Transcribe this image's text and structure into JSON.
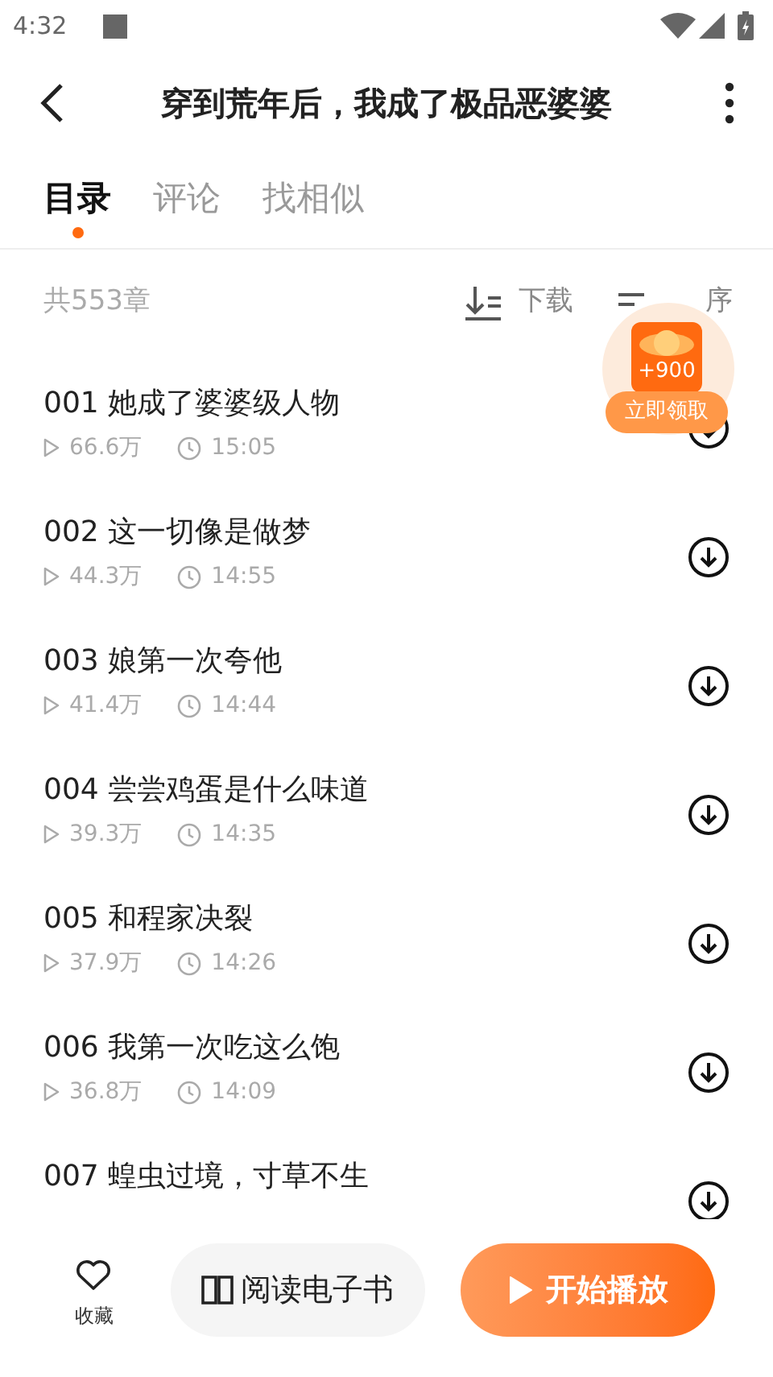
{
  "status_bar": {
    "time": "4:32"
  },
  "header": {
    "title": "穿到荒年后，我成了极品恶婆婆"
  },
  "tabs": [
    {
      "label": "目录",
      "selected": true
    },
    {
      "label": "评论",
      "selected": false
    },
    {
      "label": "找相似",
      "selected": false
    }
  ],
  "toolbar": {
    "count": "共553章",
    "download": "下载",
    "sort": "序"
  },
  "reward_badge": {
    "amount": "+900",
    "button": "立即领取"
  },
  "chapters": [
    {
      "title": "001 她成了婆婆级人物",
      "plays": "66.6万",
      "duration": "15:05"
    },
    {
      "title": "002 这一切像是做梦",
      "plays": "44.3万",
      "duration": "14:55"
    },
    {
      "title": "003 娘第一次夸他",
      "plays": "41.4万",
      "duration": "14:44"
    },
    {
      "title": "004 尝尝鸡蛋是什么味道",
      "plays": "39.3万",
      "duration": "14:35"
    },
    {
      "title": "005 和程家决裂",
      "plays": "37.9万",
      "duration": "14:26"
    },
    {
      "title": "006 我第一次吃这么饱",
      "plays": "36.8万",
      "duration": "14:09"
    },
    {
      "title": "007 蝗虫过境，寸草不生"
    }
  ],
  "bottom_bar": {
    "favorite": "收藏",
    "read_ebook": "阅读电子书",
    "play": "开始播放"
  }
}
